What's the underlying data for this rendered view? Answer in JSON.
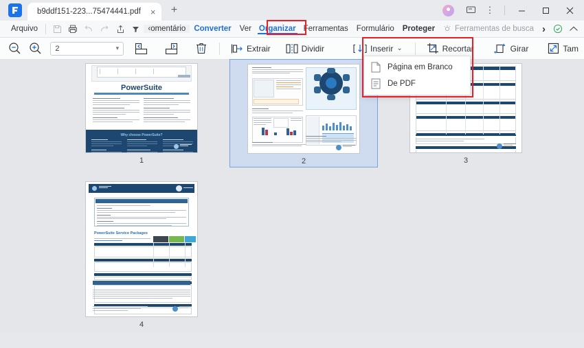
{
  "window": {
    "tab_title": "b9ddf151-223...75474441.pdf",
    "new_tab_label": "+",
    "close_tab_label": "×",
    "minimize_label": "─",
    "maximize_label": "□",
    "close_label": "✕",
    "more_label": "⋮",
    "accent_blue": "#1f6fe0",
    "annotation_red": "#ee1c25"
  },
  "menubar": {
    "file": "Arquivo",
    "items": [
      {
        "label": "omentário",
        "style": "normal"
      },
      {
        "label": "Converter",
        "style": "blue"
      },
      {
        "label": "Ver",
        "style": "normal"
      },
      {
        "label": "Organizar",
        "style": "active"
      },
      {
        "label": "Ferramentas",
        "style": "normal"
      },
      {
        "label": "Formulário",
        "style": "normal"
      },
      {
        "label": "Proteger",
        "style": "normal"
      },
      {
        "label": "Ferramentas de busca",
        "style": "muted"
      }
    ],
    "chevron": "›"
  },
  "toolbar": {
    "page_value": "2",
    "page_caret": "▾",
    "extract_label": "Extrair",
    "split_label": "Dividir",
    "insert_label": "Inserir",
    "insert_caret": "⌄",
    "crop_label": "Recortar",
    "rotate_label": "Girar",
    "size_label": "Tam"
  },
  "insert_menu": {
    "items": [
      {
        "label": "Página em Branco",
        "icon": "blank-page-icon"
      },
      {
        "label": "De PDF",
        "icon": "pdf-page-icon"
      }
    ]
  },
  "pages": {
    "items": [
      {
        "number": "1",
        "selected": false,
        "kind": "cover"
      },
      {
        "number": "2",
        "selected": true,
        "kind": "charts"
      },
      {
        "number": "3",
        "selected": false,
        "kind": "table"
      },
      {
        "number": "4",
        "selected": false,
        "kind": "packages"
      }
    ],
    "page4_heading": "PowerSuite Service Packages",
    "page1_title": "PowerSuite",
    "page1_subtitle": "One tool to monitor, analyze and secure collaboration & communications platform",
    "page1_section": "Why choose PowerSuite?"
  }
}
